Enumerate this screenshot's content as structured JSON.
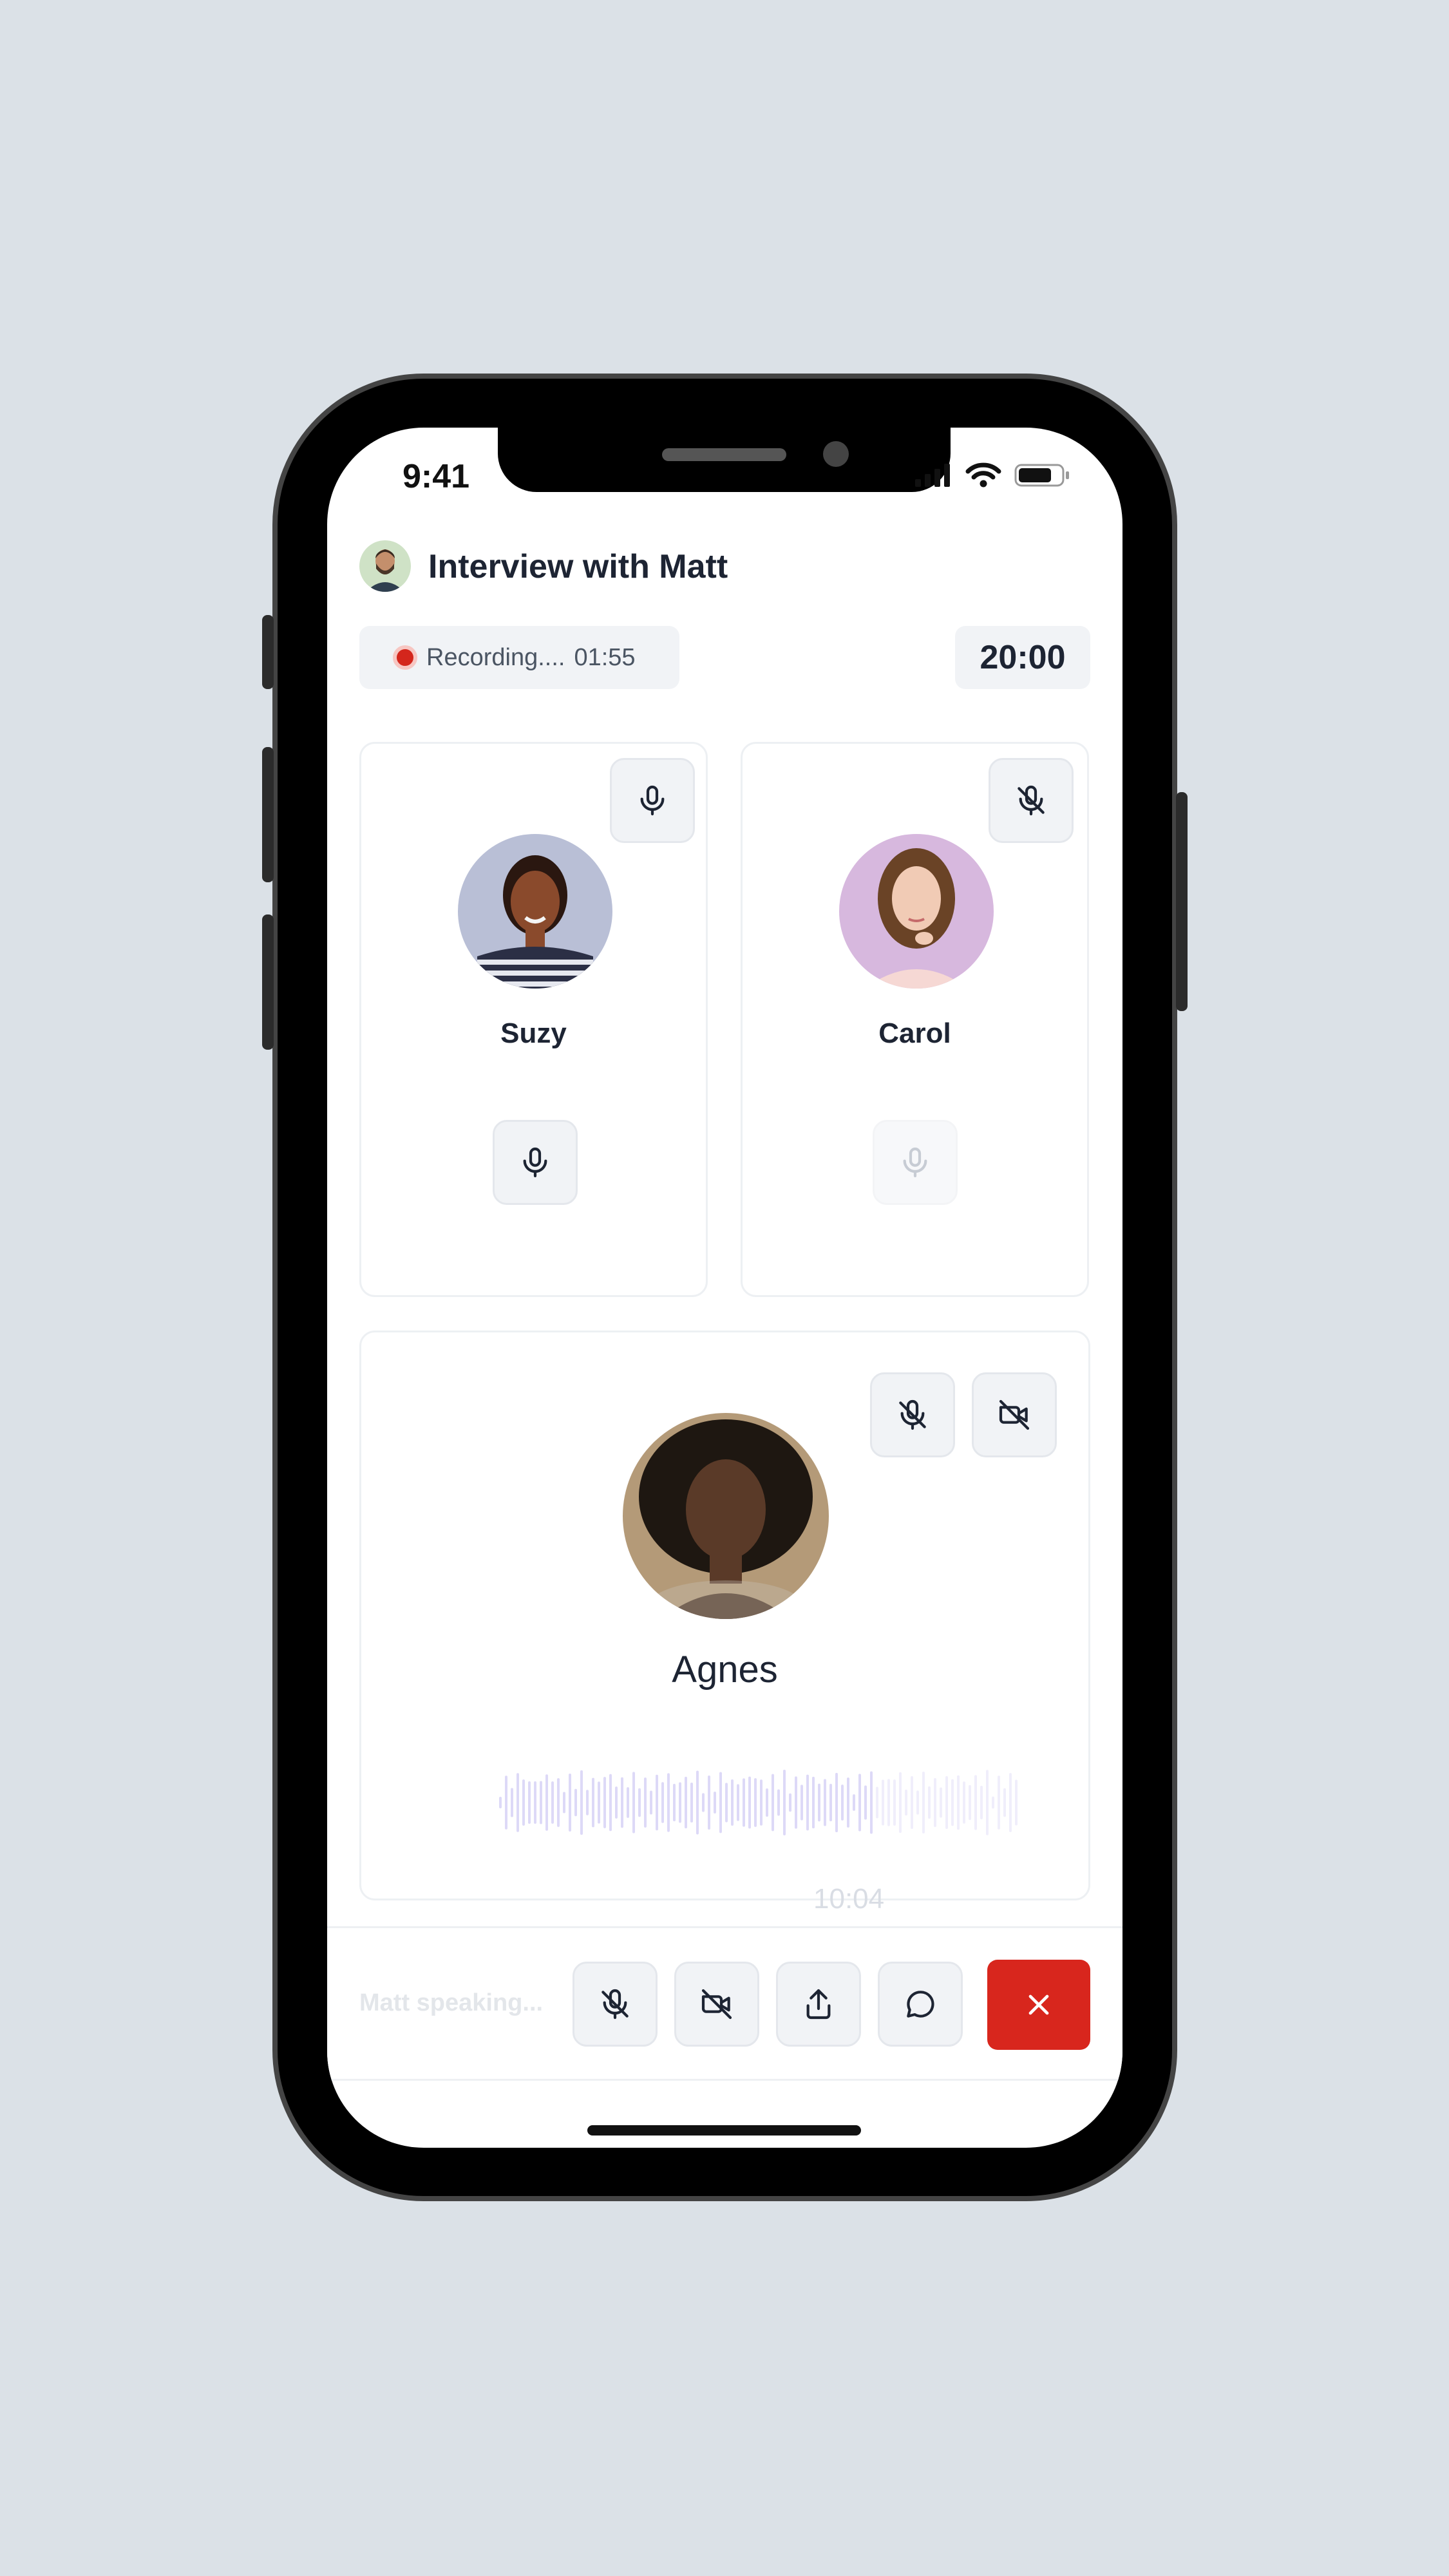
{
  "status_bar": {
    "time": "9:41"
  },
  "header": {
    "title": "Interview with Matt",
    "avatar": "host-avatar"
  },
  "recording": {
    "label": "Recording....",
    "elapsed": "01:55"
  },
  "timer": "20:00",
  "participants": [
    {
      "name": "Suzy",
      "mic": "on",
      "avatar_bg": "#b9bfd6"
    },
    {
      "name": "Carol",
      "mic": "muted",
      "avatar_bg": "#d7b8de"
    }
  ],
  "featured": {
    "name": "Agnes",
    "mic": "muted",
    "camera": "off",
    "avatar_bg": "#b49a78",
    "timestamp": "10:04"
  },
  "footer": {
    "speaking_label": "Matt speaking..."
  },
  "colors": {
    "accent_red": "#d8261d",
    "waveform": "#ddd9f7",
    "text_dark": "#1d2433"
  },
  "icons": [
    "mic-icon",
    "mic-off-icon",
    "video-off-icon",
    "share-icon",
    "chat-icon",
    "close-icon"
  ]
}
